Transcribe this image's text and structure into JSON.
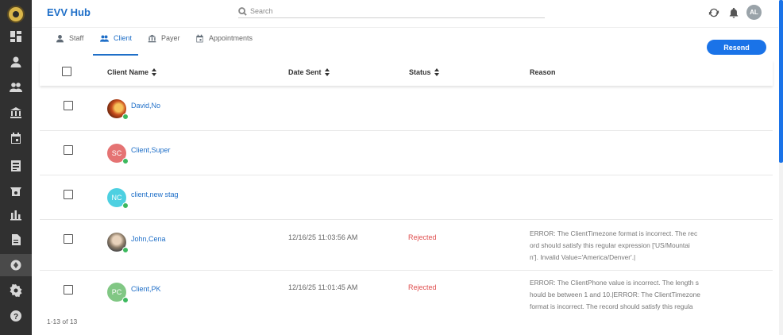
{
  "app": {
    "title": "EVV Hub"
  },
  "search": {
    "placeholder": "Search"
  },
  "user": {
    "initials": "AL"
  },
  "tabs": [
    {
      "label": "Staff",
      "icon": "person-icon"
    },
    {
      "label": "Client",
      "icon": "people-icon",
      "active": true
    },
    {
      "label": "Payer",
      "icon": "bank-icon"
    },
    {
      "label": "Appointments",
      "icon": "calendar-icon"
    }
  ],
  "actions": {
    "resend_label": "Resend"
  },
  "table": {
    "columns": [
      "Client Name",
      "Date Sent",
      "Status",
      "Reason"
    ],
    "rows": [
      {
        "name": "David,No",
        "avatar": "photo",
        "date": "",
        "status": "",
        "reason": []
      },
      {
        "name": "Client,Super",
        "avatar": "SC",
        "avatar_color": "#e57373",
        "date": "",
        "status": "",
        "reason": []
      },
      {
        "name": "client,new stag",
        "avatar": "NC",
        "avatar_color": "#4dd0e1",
        "date": "",
        "status": "",
        "reason": []
      },
      {
        "name": "John,Cena",
        "avatar": "photo",
        "date": "12/16/25 11:03:56 AM",
        "status": "Rejected",
        "reason": [
          "ERROR: The ClientTimezone format is incorrect. The rec",
          "ord should satisfy this regular expression ['US/Mountai",
          "n']. Invalid Value='America/Denver'.|"
        ]
      },
      {
        "name": "Client,PK",
        "avatar": "PC",
        "avatar_color": "#81c784",
        "date": "12/16/25 11:01:45 AM",
        "status": "Rejected",
        "reason": [
          "ERROR: The ClientPhone value is incorrect. The length s",
          "hould be between 1 and 10.|ERROR: The ClientTimezone",
          "format is incorrect. The record should satisfy this regula"
        ]
      }
    ]
  },
  "pagination": {
    "text": "1-13 of 13"
  },
  "colors": {
    "accent": "#1a73e8",
    "rejected": "#e05050",
    "rail": "#303030",
    "online": "#3cb95e"
  }
}
